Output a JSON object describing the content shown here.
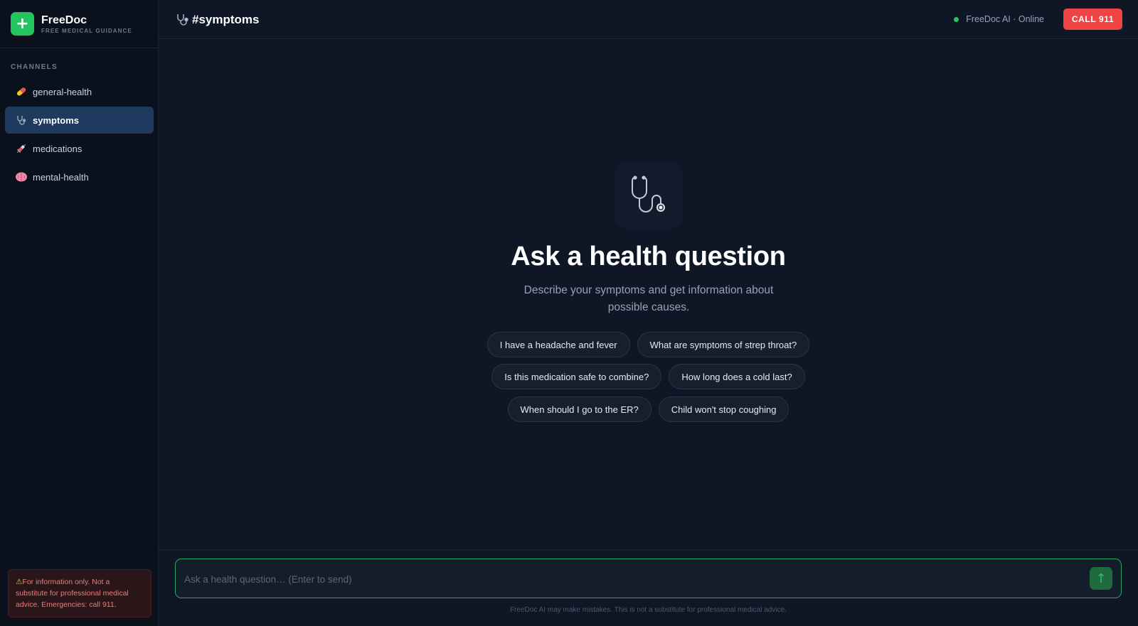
{
  "brand": {
    "name": "FreeDoc",
    "tagline": "FREE MEDICAL GUIDANCE",
    "logo_icon": "plus-icon"
  },
  "sidebar": {
    "section_title": "CHANNELS",
    "channels": [
      {
        "label": "general-health",
        "icon": "pill-icon",
        "active": false
      },
      {
        "label": "symptoms",
        "icon": "stethoscope-icon",
        "active": true
      },
      {
        "label": "medications",
        "icon": "syringe-icon",
        "active": false
      },
      {
        "label": "mental-health",
        "icon": "brain-icon",
        "active": false
      }
    ],
    "disclaimer": "For information only. Not a substitute for professional medical advice. Emergencies: call 911."
  },
  "header": {
    "channel_title": "#symptoms",
    "status_text": "FreeDoc AI · Online",
    "call_button": "CALL 911"
  },
  "hero": {
    "icon": "stethoscope-icon",
    "title": "Ask a health question",
    "subtitle": "Describe your symptoms and get information about possible causes."
  },
  "suggestions": [
    "I have a headache and fever",
    "What are symptoms of strep throat?",
    "Is this medication safe to combine?",
    "How long does a cold last?",
    "When should I go to the ER?",
    "Child won't stop coughing"
  ],
  "composer": {
    "placeholder": "Ask a health question… (Enter to send)",
    "value": "",
    "send_icon": "arrow-up-icon",
    "footer_note": "FreeDoc AI may make mistakes. This is not a substitute for professional medical advice."
  },
  "colors": {
    "background": "#0f1726",
    "sidebar": "#0b111c",
    "accent": "#22c55e",
    "active_channel": "#1e3a5f",
    "danger": "#ef4444"
  }
}
